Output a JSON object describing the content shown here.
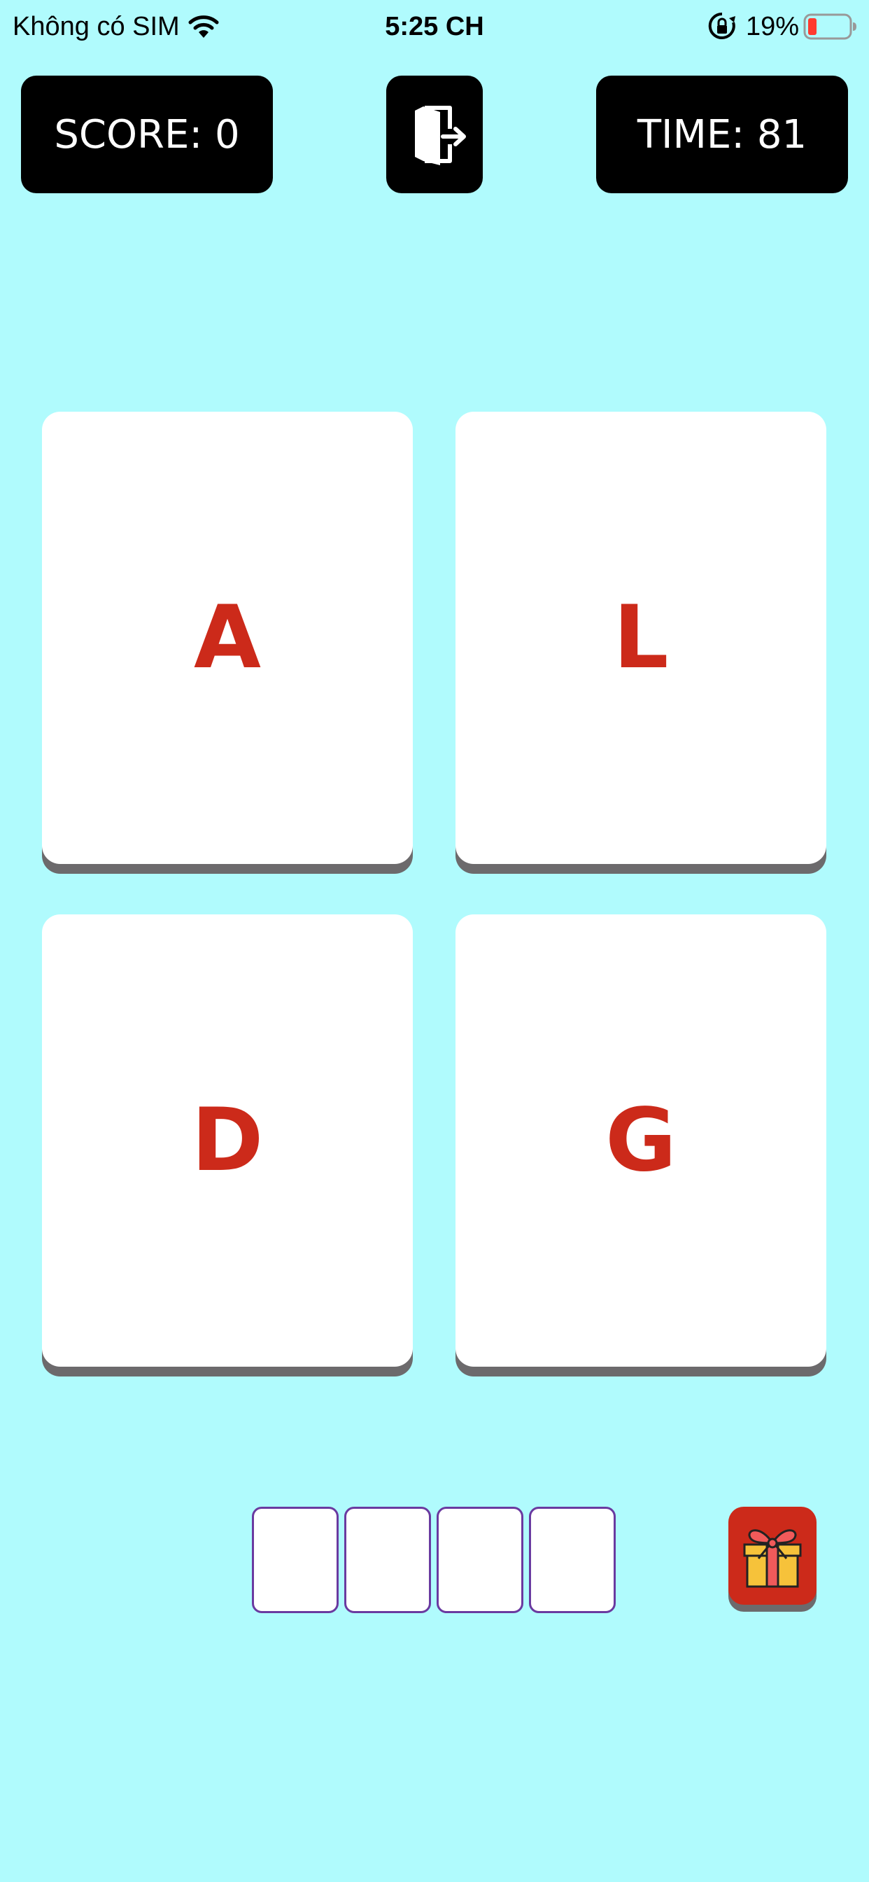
{
  "status_bar": {
    "carrier": "Không có SIM",
    "time": "5:25 CH",
    "battery_percent": "19%",
    "icons": [
      "wifi-icon",
      "lock-rotation-icon",
      "battery-icon"
    ]
  },
  "hud": {
    "score_label": "SCORE: 0",
    "time_label": "TIME: 81",
    "exit_icon": "exit-door-icon"
  },
  "cards": [
    {
      "letter": "A"
    },
    {
      "letter": "L"
    },
    {
      "letter": "D"
    },
    {
      "letter": "G"
    }
  ],
  "answer_slots": [
    "",
    "",
    "",
    ""
  ],
  "gift_button": {
    "icon": "gift-icon"
  },
  "colors": {
    "background": "#b0fbfd",
    "letter": "#cc2a1a",
    "card": "#ffffff",
    "card_shadow": "#6c6a6c",
    "hud": "#000000",
    "slot_border": "#6a3aa0",
    "gift_button": "#cc2a1a",
    "battery_low": "#ff3b30"
  }
}
